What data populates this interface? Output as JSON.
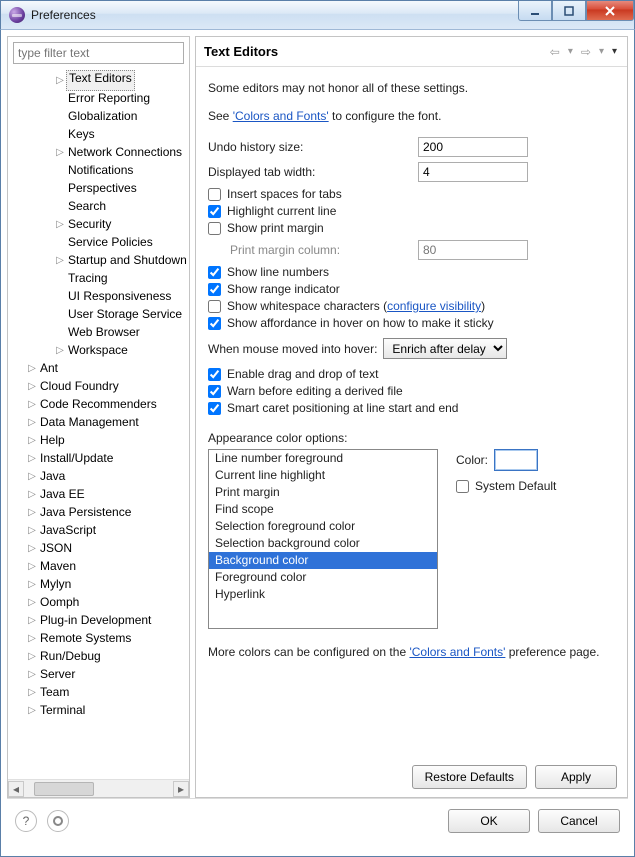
{
  "window": {
    "title": "Preferences"
  },
  "filter": {
    "placeholder": "type filter text"
  },
  "tree": [
    {
      "indent": 3,
      "expand": "closed",
      "label": "Text Editors",
      "selected": true
    },
    {
      "indent": 3,
      "expand": "",
      "label": "Error Reporting"
    },
    {
      "indent": 3,
      "expand": "",
      "label": "Globalization"
    },
    {
      "indent": 3,
      "expand": "",
      "label": "Keys"
    },
    {
      "indent": 3,
      "expand": "closed",
      "label": "Network Connections"
    },
    {
      "indent": 3,
      "expand": "",
      "label": "Notifications"
    },
    {
      "indent": 3,
      "expand": "",
      "label": "Perspectives"
    },
    {
      "indent": 3,
      "expand": "",
      "label": "Search"
    },
    {
      "indent": 3,
      "expand": "closed",
      "label": "Security"
    },
    {
      "indent": 3,
      "expand": "",
      "label": "Service Policies"
    },
    {
      "indent": 3,
      "expand": "closed",
      "label": "Startup and Shutdown"
    },
    {
      "indent": 3,
      "expand": "",
      "label": "Tracing"
    },
    {
      "indent": 3,
      "expand": "",
      "label": "UI Responsiveness"
    },
    {
      "indent": 3,
      "expand": "",
      "label": "User Storage Service"
    },
    {
      "indent": 3,
      "expand": "",
      "label": "Web Browser"
    },
    {
      "indent": 3,
      "expand": "closed",
      "label": "Workspace"
    },
    {
      "indent": 1,
      "expand": "closed",
      "label": "Ant"
    },
    {
      "indent": 1,
      "expand": "closed",
      "label": "Cloud Foundry"
    },
    {
      "indent": 1,
      "expand": "closed",
      "label": "Code Recommenders"
    },
    {
      "indent": 1,
      "expand": "closed",
      "label": "Data Management"
    },
    {
      "indent": 1,
      "expand": "closed",
      "label": "Help"
    },
    {
      "indent": 1,
      "expand": "closed",
      "label": "Install/Update"
    },
    {
      "indent": 1,
      "expand": "closed",
      "label": "Java"
    },
    {
      "indent": 1,
      "expand": "closed",
      "label": "Java EE"
    },
    {
      "indent": 1,
      "expand": "closed",
      "label": "Java Persistence"
    },
    {
      "indent": 1,
      "expand": "closed",
      "label": "JavaScript"
    },
    {
      "indent": 1,
      "expand": "closed",
      "label": "JSON"
    },
    {
      "indent": 1,
      "expand": "closed",
      "label": "Maven"
    },
    {
      "indent": 1,
      "expand": "closed",
      "label": "Mylyn"
    },
    {
      "indent": 1,
      "expand": "closed",
      "label": "Oomph"
    },
    {
      "indent": 1,
      "expand": "closed",
      "label": "Plug-in Development"
    },
    {
      "indent": 1,
      "expand": "closed",
      "label": "Remote Systems"
    },
    {
      "indent": 1,
      "expand": "closed",
      "label": "Run/Debug"
    },
    {
      "indent": 1,
      "expand": "closed",
      "label": "Server"
    },
    {
      "indent": 1,
      "expand": "closed",
      "label": "Team"
    },
    {
      "indent": 1,
      "expand": "closed",
      "label": "Terminal"
    }
  ],
  "page": {
    "title": "Text Editors",
    "intro": "Some editors may not honor all of these settings.",
    "see_prefix": "See ",
    "see_link": "'Colors and Fonts'",
    "see_suffix": " to configure the font.",
    "undo_label": "Undo history size:",
    "undo_value": "200",
    "tab_label": "Displayed tab width:",
    "tab_value": "4",
    "chk_spaces": "Insert spaces for tabs",
    "chk_highlight": "Highlight current line",
    "chk_printmargin": "Show print margin",
    "printmargin_label": "Print margin column:",
    "printmargin_value": "80",
    "chk_linenum": "Show line numbers",
    "chk_range": "Show range indicator",
    "chk_whitespace_prefix": "Show whitespace characters (",
    "chk_whitespace_link": "configure visibility",
    "chk_whitespace_suffix": ")",
    "chk_affordance": "Show affordance in hover on how to make it sticky",
    "hover_label": "When mouse moved into hover:",
    "hover_value": "Enrich after delay",
    "chk_drag": "Enable drag and drop of text",
    "chk_warn": "Warn before editing a derived file",
    "chk_caret": "Smart caret positioning at line start and end",
    "appearance_label": "Appearance color options:",
    "appearance_items": [
      "Line number foreground",
      "Current line highlight",
      "Print margin",
      "Find scope",
      "Selection foreground color",
      "Selection background color",
      "Background color",
      "Foreground color",
      "Hyperlink"
    ],
    "appearance_selected_index": 6,
    "color_label": "Color:",
    "sysdefault_label": "System Default",
    "more_prefix": "More colors can be configured on the ",
    "more_link": "'Colors and Fonts'",
    "more_suffix": " preference page.",
    "restore": "Restore Defaults",
    "apply": "Apply"
  },
  "footer": {
    "ok": "OK",
    "cancel": "Cancel"
  }
}
